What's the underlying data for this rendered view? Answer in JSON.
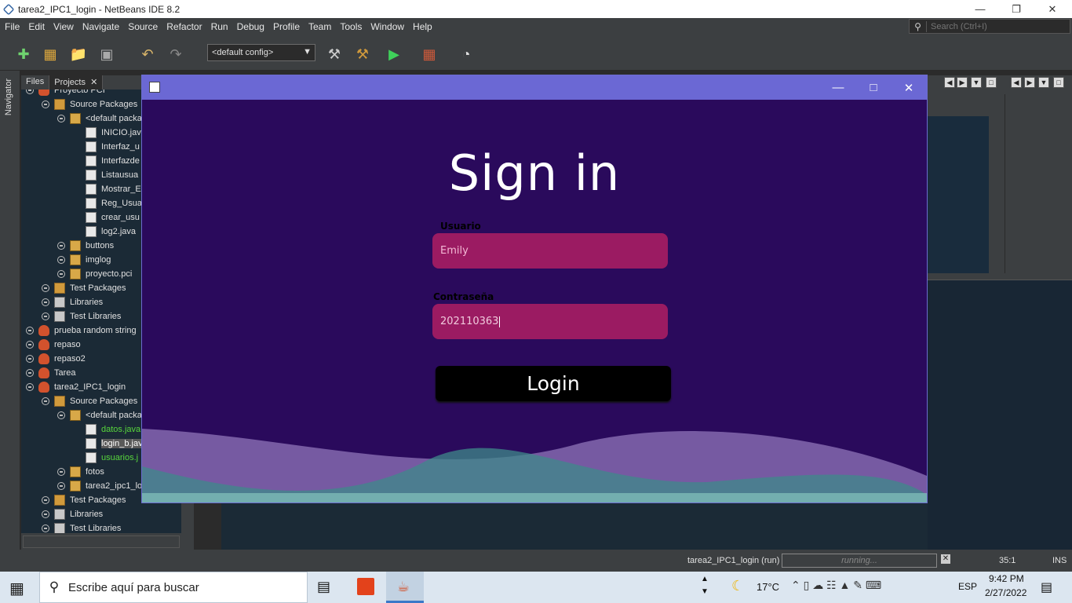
{
  "window": {
    "title": "tarea2_IPC1_login - NetBeans IDE 8.2"
  },
  "menu": [
    "File",
    "Edit",
    "View",
    "Navigate",
    "Source",
    "Refactor",
    "Run",
    "Debug",
    "Profile",
    "Team",
    "Tools",
    "Window",
    "Help"
  ],
  "search": {
    "placeholder": "Search (Ctrl+I)"
  },
  "toolbar": {
    "config": "<default config>"
  },
  "navigator": {
    "label": "Navigator"
  },
  "panel": {
    "tab_files": "Files",
    "tab_projects": "Projects"
  },
  "tree": [
    {
      "label": "Proyecto PCI",
      "indent": 0,
      "icon": "proj",
      "y": -2
    },
    {
      "label": "Source Packages",
      "indent": 1,
      "icon": "pkgs"
    },
    {
      "label": "<default packa",
      "indent": 2,
      "icon": "pkg"
    },
    {
      "label": "INICIO.java",
      "indent": 3,
      "icon": "java"
    },
    {
      "label": "Interfaz_u",
      "indent": 3,
      "icon": "java"
    },
    {
      "label": "Interfazde",
      "indent": 3,
      "icon": "java"
    },
    {
      "label": "Listausua",
      "indent": 3,
      "icon": "java"
    },
    {
      "label": "Mostrar_E",
      "indent": 3,
      "icon": "java"
    },
    {
      "label": "Reg_Usua",
      "indent": 3,
      "icon": "java"
    },
    {
      "label": "crear_usu",
      "indent": 3,
      "icon": "java"
    },
    {
      "label": "log2.java",
      "indent": 3,
      "icon": "java"
    },
    {
      "label": "buttons",
      "indent": 2,
      "icon": "pkg"
    },
    {
      "label": "imglog",
      "indent": 2,
      "icon": "pkg"
    },
    {
      "label": "proyecto.pci",
      "indent": 2,
      "icon": "pkg"
    },
    {
      "label": "Test Packages",
      "indent": 1,
      "icon": "pkgs"
    },
    {
      "label": "Libraries",
      "indent": 1,
      "icon": "lib"
    },
    {
      "label": "Test Libraries",
      "indent": 1,
      "icon": "lib"
    },
    {
      "label": "prueba random string",
      "indent": 0,
      "icon": "proj"
    },
    {
      "label": "repaso",
      "indent": 0,
      "icon": "proj"
    },
    {
      "label": "repaso2",
      "indent": 0,
      "icon": "proj"
    },
    {
      "label": "Tarea",
      "indent": 0,
      "icon": "proj"
    },
    {
      "label": "tarea2_IPC1_login",
      "indent": 0,
      "icon": "proj"
    },
    {
      "label": "Source Packages",
      "indent": 1,
      "icon": "pkgs"
    },
    {
      "label": "<default packa",
      "indent": 2,
      "icon": "pkg"
    },
    {
      "label": "datos.java",
      "indent": 3,
      "icon": "java",
      "state": "green"
    },
    {
      "label": "login_b.jav",
      "indent": 3,
      "icon": "java",
      "state": "sel"
    },
    {
      "label": "usuarios.j",
      "indent": 3,
      "icon": "java",
      "state": "green"
    },
    {
      "label": "fotos",
      "indent": 2,
      "icon": "pkg"
    },
    {
      "label": "tarea2_ipc1_lo",
      "indent": 2,
      "icon": "pkg"
    },
    {
      "label": "Test Packages",
      "indent": 1,
      "icon": "pkgs"
    },
    {
      "label": "Libraries",
      "indent": 1,
      "icon": "lib"
    },
    {
      "label": "Test Libraries",
      "indent": 1,
      "icon": "lib"
    }
  ],
  "status": {
    "running_label": "tarea2_IPC1_login (run)",
    "progress_text": "running...",
    "position": "35:1",
    "mode": "INS"
  },
  "login": {
    "heading": "Sign in",
    "user_label": "Usuario",
    "user_value": "Emily",
    "pass_label": "Contraseña",
    "pass_value": "202110363",
    "button": "Login"
  },
  "taskbar": {
    "search_text": "Escribe aquí para buscar",
    "temp": "17°C",
    "lang": "ESP",
    "time": "9:42 PM",
    "date": "2/27/2022"
  }
}
